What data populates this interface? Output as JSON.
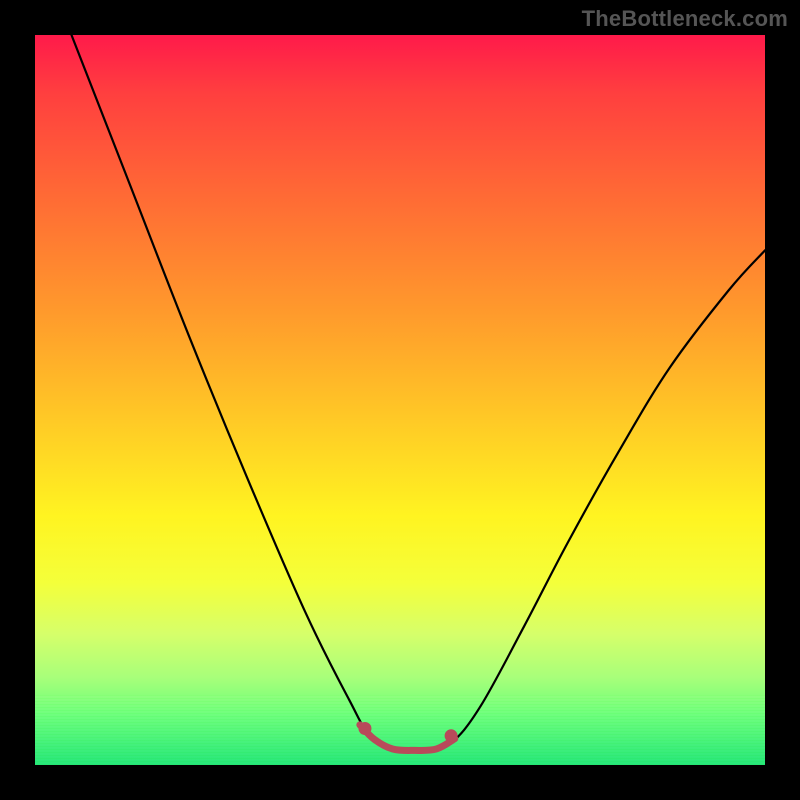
{
  "watermark": "TheBottleneck.com",
  "chart_data": {
    "type": "line",
    "title": "",
    "xlabel": "",
    "ylabel": "",
    "xlim": [
      0,
      1
    ],
    "ylim": [
      0,
      1
    ],
    "grid": false,
    "legend": false,
    "annotations": [],
    "series": [
      {
        "name": "V-curve",
        "color": "#000000",
        "x": [
          0.05,
          0.13,
          0.21,
          0.29,
          0.37,
          0.43,
          0.46,
          0.5,
          0.54,
          0.57,
          0.61,
          0.67,
          0.73,
          0.8,
          0.87,
          0.95,
          1.0
        ],
        "y": [
          1.0,
          0.795,
          0.59,
          0.395,
          0.21,
          0.09,
          0.04,
          0.02,
          0.02,
          0.03,
          0.08,
          0.19,
          0.305,
          0.43,
          0.545,
          0.65,
          0.705
        ]
      },
      {
        "name": "trough-highlight",
        "color": "#b84a5a",
        "x": [
          0.445,
          0.465,
          0.49,
          0.52,
          0.55,
          0.575
        ],
        "y": [
          0.055,
          0.035,
          0.022,
          0.02,
          0.022,
          0.036
        ]
      }
    ],
    "trough_markers": {
      "color": "#b84a5a",
      "points": [
        {
          "x": 0.452,
          "y": 0.05
        },
        {
          "x": 0.57,
          "y": 0.04
        }
      ]
    }
  },
  "colors": {
    "background": "#000000",
    "watermark": "#555555",
    "curve": "#000000",
    "highlight": "#b84a5a"
  }
}
